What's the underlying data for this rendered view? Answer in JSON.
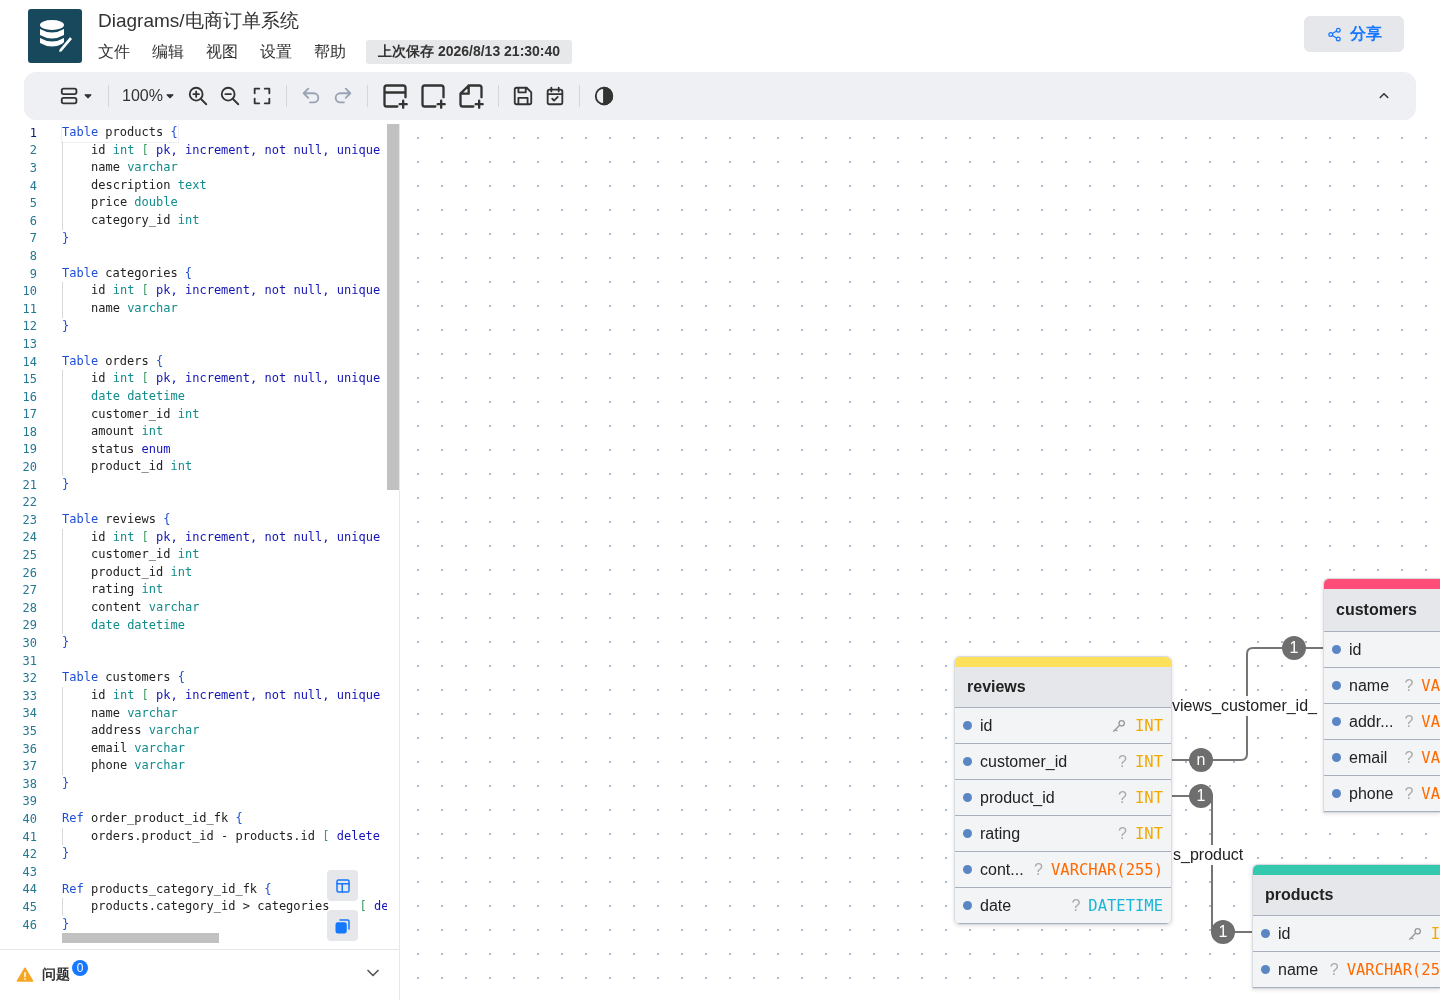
{
  "header": {
    "title": "Diagrams/电商订单系统",
    "menu": [
      "文件",
      "编辑",
      "视图",
      "设置",
      "帮助"
    ],
    "last_saved": "上次保存 2026/8/13 21:30:40",
    "share": "分享"
  },
  "toolbar": {
    "zoom": "100%",
    "undo_disabled": true,
    "redo_disabled": true
  },
  "editor": {
    "lines": [
      {
        "n": "1",
        "active": true,
        "indent": false,
        "tokens": [
          {
            "text": "Table",
            "kind": "kw"
          },
          {
            "text": "products",
            "kind": "plain"
          },
          {
            "text": "{",
            "kind": "kw"
          }
        ]
      },
      {
        "n": "2",
        "active": false,
        "indent": true,
        "tokens": [
          {
            "text": "id",
            "kind": "plain"
          },
          {
            "text": "int",
            "kind": "type"
          },
          {
            "text": "[",
            "kind": "punct"
          },
          {
            "text": "pk,",
            "kind": "attr"
          },
          {
            "text": "increment,",
            "kind": "attr"
          },
          {
            "text": "not",
            "kind": "attr"
          },
          {
            "text": "null,",
            "kind": "attr"
          },
          {
            "text": "unique",
            "kind": "attr"
          }
        ]
      },
      {
        "n": "3",
        "active": false,
        "indent": true,
        "tokens": [
          {
            "text": "name",
            "kind": "plain"
          },
          {
            "text": "varchar",
            "kind": "type"
          }
        ]
      },
      {
        "n": "4",
        "active": false,
        "indent": true,
        "tokens": [
          {
            "text": "description",
            "kind": "plain"
          },
          {
            "text": "text",
            "kind": "type"
          }
        ]
      },
      {
        "n": "5",
        "active": false,
        "indent": true,
        "tokens": [
          {
            "text": "price",
            "kind": "plain"
          },
          {
            "text": "double",
            "kind": "type"
          }
        ]
      },
      {
        "n": "6",
        "active": false,
        "indent": true,
        "tokens": [
          {
            "text": "category_id",
            "kind": "plain"
          },
          {
            "text": "int",
            "kind": "type"
          }
        ]
      },
      {
        "n": "7",
        "active": false,
        "indent": false,
        "tokens": [
          {
            "text": "}",
            "kind": "kw"
          }
        ]
      },
      {
        "n": "8",
        "active": false
      },
      {
        "n": "9",
        "active": false,
        "indent": false,
        "tokens": [
          {
            "text": "Table",
            "kind": "kw"
          },
          {
            "text": "categories",
            "kind": "plain"
          },
          {
            "text": "{",
            "kind": "kw"
          }
        ]
      },
      {
        "n": "10",
        "active": false,
        "indent": true,
        "tokens": [
          {
            "text": "id",
            "kind": "plain"
          },
          {
            "text": "int",
            "kind": "type"
          },
          {
            "text": "[",
            "kind": "punct"
          },
          {
            "text": "pk,",
            "kind": "attr"
          },
          {
            "text": "increment,",
            "kind": "attr"
          },
          {
            "text": "not",
            "kind": "attr"
          },
          {
            "text": "null,",
            "kind": "attr"
          },
          {
            "text": "unique",
            "kind": "attr"
          }
        ]
      },
      {
        "n": "11",
        "active": false,
        "indent": true,
        "tokens": [
          {
            "text": "name",
            "kind": "plain"
          },
          {
            "text": "varchar",
            "kind": "type"
          }
        ]
      },
      {
        "n": "12",
        "active": false,
        "indent": false,
        "tokens": [
          {
            "text": "}",
            "kind": "kw"
          }
        ]
      },
      {
        "n": "13",
        "active": false
      },
      {
        "n": "14",
        "active": false,
        "indent": false,
        "tokens": [
          {
            "text": "Table",
            "kind": "kw"
          },
          {
            "text": "orders",
            "kind": "plain"
          },
          {
            "text": "{",
            "kind": "kw"
          }
        ]
      },
      {
        "n": "15",
        "active": false,
        "indent": true,
        "tokens": [
          {
            "text": "id",
            "kind": "plain"
          },
          {
            "text": "int",
            "kind": "type"
          },
          {
            "text": "[",
            "kind": "punct"
          },
          {
            "text": "pk,",
            "kind": "attr"
          },
          {
            "text": "increment,",
            "kind": "attr"
          },
          {
            "text": "not",
            "kind": "attr"
          },
          {
            "text": "null,",
            "kind": "attr"
          },
          {
            "text": "unique",
            "kind": "attr"
          }
        ]
      },
      {
        "n": "16",
        "active": false,
        "indent": true,
        "tokens": [
          {
            "text": "date",
            "kind": "type"
          },
          {
            "text": "datetime",
            "kind": "type"
          }
        ]
      },
      {
        "n": "17",
        "active": false,
        "indent": true,
        "tokens": [
          {
            "text": "customer_id",
            "kind": "plain"
          },
          {
            "text": "int",
            "kind": "type"
          }
        ]
      },
      {
        "n": "18",
        "active": false,
        "indent": true,
        "tokens": [
          {
            "text": "amount",
            "kind": "plain"
          },
          {
            "text": "int",
            "kind": "type"
          }
        ]
      },
      {
        "n": "19",
        "active": false,
        "indent": true,
        "tokens": [
          {
            "text": "status",
            "kind": "plain"
          },
          {
            "text": "enum",
            "kind": "attr"
          }
        ]
      },
      {
        "n": "20",
        "active": false,
        "indent": true,
        "tokens": [
          {
            "text": "product_id",
            "kind": "plain"
          },
          {
            "text": "int",
            "kind": "type"
          }
        ]
      },
      {
        "n": "21",
        "active": false,
        "indent": false,
        "tokens": [
          {
            "text": "}",
            "kind": "kw"
          }
        ]
      },
      {
        "n": "22",
        "active": false
      },
      {
        "n": "23",
        "active": false,
        "indent": false,
        "tokens": [
          {
            "text": "Table",
            "kind": "kw"
          },
          {
            "text": "reviews",
            "kind": "plain"
          },
          {
            "text": "{",
            "kind": "kw"
          }
        ]
      },
      {
        "n": "24",
        "active": false,
        "indent": true,
        "tokens": [
          {
            "text": "id",
            "kind": "plain"
          },
          {
            "text": "int",
            "kind": "type"
          },
          {
            "text": "[",
            "kind": "punct"
          },
          {
            "text": "pk,",
            "kind": "attr"
          },
          {
            "text": "increment,",
            "kind": "attr"
          },
          {
            "text": "not",
            "kind": "attr"
          },
          {
            "text": "null,",
            "kind": "attr"
          },
          {
            "text": "unique",
            "kind": "attr"
          }
        ]
      },
      {
        "n": "25",
        "active": false,
        "indent": true,
        "tokens": [
          {
            "text": "customer_id",
            "kind": "plain"
          },
          {
            "text": "int",
            "kind": "type"
          }
        ]
      },
      {
        "n": "26",
        "active": false,
        "indent": true,
        "tokens": [
          {
            "text": "product_id",
            "kind": "plain"
          },
          {
            "text": "int",
            "kind": "type"
          }
        ]
      },
      {
        "n": "27",
        "active": false,
        "indent": true,
        "tokens": [
          {
            "text": "rating",
            "kind": "plain"
          },
          {
            "text": "int",
            "kind": "type"
          }
        ]
      },
      {
        "n": "28",
        "active": false,
        "indent": true,
        "tokens": [
          {
            "text": "content",
            "kind": "plain"
          },
          {
            "text": "varchar",
            "kind": "type"
          }
        ]
      },
      {
        "n": "29",
        "active": false,
        "indent": true,
        "tokens": [
          {
            "text": "date",
            "kind": "type"
          },
          {
            "text": "datetime",
            "kind": "type"
          }
        ]
      },
      {
        "n": "30",
        "active": false,
        "indent": false,
        "tokens": [
          {
            "text": "}",
            "kind": "kw"
          }
        ]
      },
      {
        "n": "31",
        "active": false
      },
      {
        "n": "32",
        "active": false,
        "indent": false,
        "tokens": [
          {
            "text": "Table",
            "kind": "kw"
          },
          {
            "text": "customers",
            "kind": "plain"
          },
          {
            "text": "{",
            "kind": "kw"
          }
        ]
      },
      {
        "n": "33",
        "active": false,
        "indent": true,
        "tokens": [
          {
            "text": "id",
            "kind": "plain"
          },
          {
            "text": "int",
            "kind": "type"
          },
          {
            "text": "[",
            "kind": "punct"
          },
          {
            "text": "pk,",
            "kind": "attr"
          },
          {
            "text": "increment,",
            "kind": "attr"
          },
          {
            "text": "not",
            "kind": "attr"
          },
          {
            "text": "null,",
            "kind": "attr"
          },
          {
            "text": "unique",
            "kind": "attr"
          }
        ]
      },
      {
        "n": "34",
        "active": false,
        "indent": true,
        "tokens": [
          {
            "text": "name",
            "kind": "plain"
          },
          {
            "text": "varchar",
            "kind": "type"
          }
        ]
      },
      {
        "n": "35",
        "active": false,
        "indent": true,
        "tokens": [
          {
            "text": "address",
            "kind": "plain"
          },
          {
            "text": "varchar",
            "kind": "type"
          }
        ]
      },
      {
        "n": "36",
        "active": false,
        "indent": true,
        "tokens": [
          {
            "text": "email",
            "kind": "plain"
          },
          {
            "text": "varchar",
            "kind": "type"
          }
        ]
      },
      {
        "n": "37",
        "active": false,
        "indent": true,
        "tokens": [
          {
            "text": "phone",
            "kind": "plain"
          },
          {
            "text": "varchar",
            "kind": "type"
          }
        ]
      },
      {
        "n": "38",
        "active": false,
        "indent": false,
        "tokens": [
          {
            "text": "}",
            "kind": "kw"
          }
        ]
      },
      {
        "n": "39",
        "active": false
      },
      {
        "n": "40",
        "active": false,
        "indent": false,
        "tokens": [
          {
            "text": "Ref",
            "kind": "kw"
          },
          {
            "text": "order_product_id_fk",
            "kind": "plain"
          },
          {
            "text": "{",
            "kind": "kw"
          }
        ]
      },
      {
        "n": "41",
        "active": false,
        "indent": true,
        "tokens": [
          {
            "text": "orders.product_id",
            "kind": "plain"
          },
          {
            "text": "-",
            "kind": "plain"
          },
          {
            "text": "products.id",
            "kind": "plain"
          },
          {
            "text": "[",
            "kind": "punct"
          },
          {
            "text": "delete",
            "kind": "attr"
          }
        ]
      },
      {
        "n": "42",
        "active": false,
        "indent": false,
        "tokens": [
          {
            "text": "}",
            "kind": "kw"
          }
        ]
      },
      {
        "n": "43",
        "active": false
      },
      {
        "n": "44",
        "active": false,
        "indent": false,
        "tokens": [
          {
            "text": "Ref",
            "kind": "kw"
          },
          {
            "text": "products_category_id_fk",
            "kind": "plain"
          },
          {
            "text": "{",
            "kind": "kw"
          }
        ]
      },
      {
        "n": "45",
        "active": false,
        "indent": true,
        "tokens": [
          {
            "text": "products.category_id",
            "kind": "plain"
          },
          {
            "text": ">",
            "kind": "plain"
          },
          {
            "text": "categories",
            "kind": "plain"
          },
          {
            "text": "[",
            "kind": "punct",
            "gap": true
          },
          {
            "text": "de",
            "kind": "attr"
          }
        ]
      },
      {
        "n": "46",
        "active": false,
        "indent": false,
        "tokens": [
          {
            "text": "}",
            "kind": "kw"
          }
        ]
      }
    ]
  },
  "problems": {
    "label": "问题",
    "count": "0",
    "expanded": false
  },
  "diagram": {
    "tables": [
      {
        "name": "reviews",
        "color": "#ffe05a",
        "fields": [
          {
            "name": "id",
            "pk": true,
            "type": "INT",
            "kind": "int"
          },
          {
            "name": "customer_id",
            "pk": false,
            "mark": "?",
            "type": "INT",
            "kind": "int"
          },
          {
            "name": "product_id",
            "pk": false,
            "mark": "?",
            "type": "INT",
            "kind": "int"
          },
          {
            "name": "rating",
            "pk": false,
            "mark": "?",
            "type": "INT",
            "kind": "int"
          },
          {
            "name": "cont...",
            "pk": false,
            "mark": "?",
            "type": "VARCHAR(255)",
            "kind": "varchar"
          },
          {
            "name": "date",
            "pk": false,
            "mark": "?",
            "type": "DATETIME",
            "kind": "datetime"
          }
        ]
      },
      {
        "name": "customers",
        "color": "#ff4d7a",
        "fields": [
          {
            "name": "id",
            "pk": false
          },
          {
            "name": "name",
            "pk": false,
            "mark": "?",
            "type": "VA",
            "kind": "varchar"
          },
          {
            "name": "addr...",
            "pk": false,
            "mark": "?",
            "type": "VA",
            "kind": "varchar"
          },
          {
            "name": "email",
            "pk": false,
            "mark": "?",
            "type": "VA",
            "kind": "varchar"
          },
          {
            "name": "phone",
            "pk": false,
            "mark": "?",
            "type": "VA",
            "kind": "varchar"
          }
        ]
      },
      {
        "name": "products",
        "color": "#34c8ae",
        "fields": [
          {
            "name": "id",
            "pk": true,
            "type": "I",
            "kind": "int"
          },
          {
            "name": "name",
            "pk": false,
            "mark": "?",
            "type": "VARCHAR(25",
            "kind": "varchar"
          }
        ]
      }
    ],
    "relations": [
      {
        "label": "views_customer_id_",
        "from_card": "n",
        "to_card": "1"
      },
      {
        "label": "s_product",
        "from_card": "1",
        "to_card": "1"
      }
    ]
  }
}
